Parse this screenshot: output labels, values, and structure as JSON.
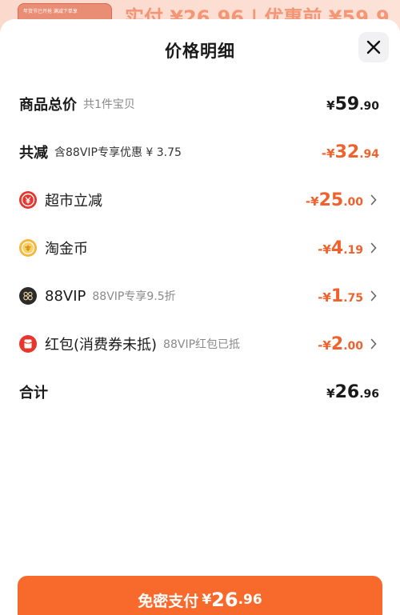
{
  "background": {
    "thumb_text": "年货节已开抢 满减下单享",
    "price_peek": "实付 ¥26.96 | 优惠前 ¥59.9"
  },
  "sheet": {
    "title": "价格明细",
    "close_icon": "close-icon"
  },
  "rows": {
    "total": {
      "label": "商品总价",
      "note": "共1件宝贝",
      "currency": "¥",
      "amount_int": "59",
      "amount_dec": ".90"
    },
    "discount": {
      "label": "共减",
      "note": "含88VIP专享优惠 ¥ 3.75",
      "currency": "-¥",
      "amount_int": "32",
      "amount_dec": ".94"
    },
    "supermarket": {
      "icon": "supermarket-icon",
      "label": "超市立减",
      "currency": "-¥",
      "amount_int": "25",
      "amount_dec": ".00"
    },
    "coins": {
      "icon": "coin-icon",
      "label": "淘金币",
      "currency": "-¥",
      "amount_int": "4",
      "amount_dec": ".19"
    },
    "vip": {
      "icon": "vip88-icon",
      "label": "88VIP",
      "note": "88VIP专享9.5折",
      "currency": "-¥",
      "amount_int": "1",
      "amount_dec": ".75"
    },
    "redpacket": {
      "icon": "red-packet-icon",
      "label": "红包(消费券未抵)",
      "note": "88VIP红包已抵",
      "currency": "-¥",
      "amount_int": "2",
      "amount_dec": ".00"
    },
    "sum": {
      "label": "合计",
      "currency": "¥",
      "amount_int": "26",
      "amount_dec": ".96"
    }
  },
  "pay_button": {
    "label": "免密支付",
    "currency": "¥",
    "amount_int": "26",
    "amount_dec": ".96"
  },
  "colors": {
    "accent": "#f86a2c",
    "discount_text": "#f0622d",
    "vip_icon": "#2b2b2b"
  }
}
